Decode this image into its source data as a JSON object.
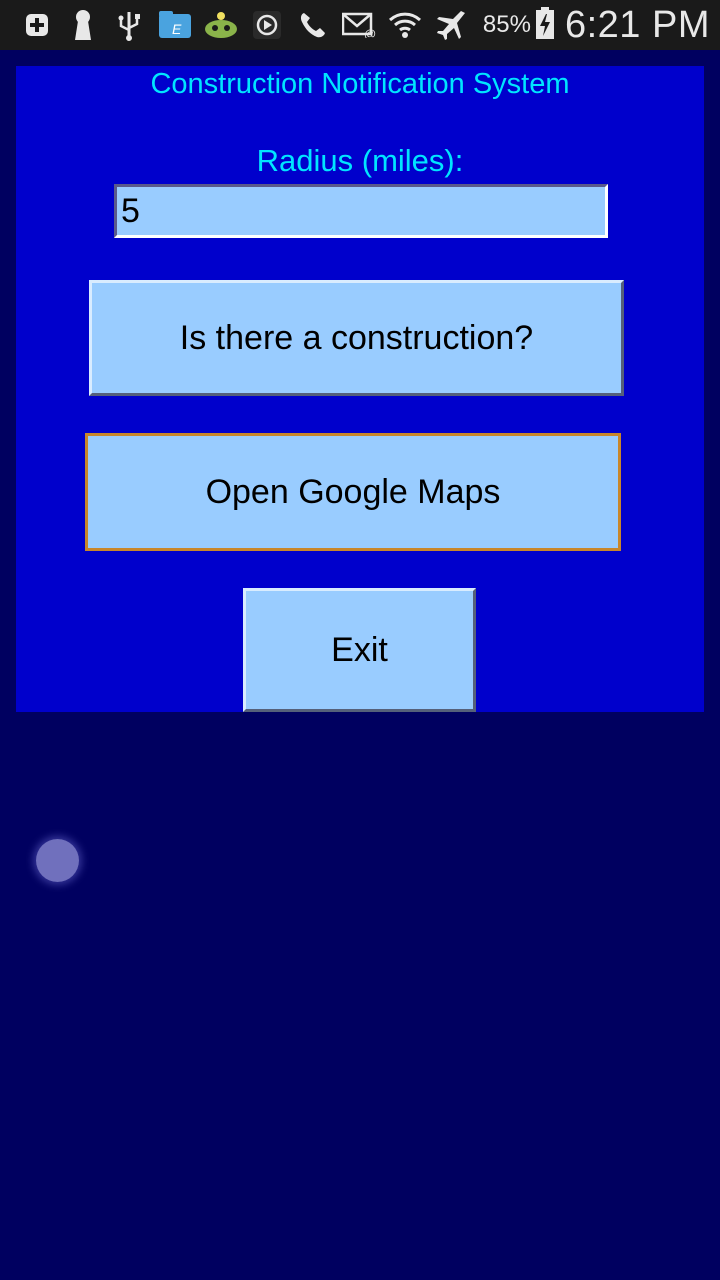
{
  "status_bar": {
    "icons": [
      "add-box-icon",
      "keyhole-icon",
      "usb-icon",
      "file-manager-icon",
      "android-icon",
      "play-icon",
      "phone-icon",
      "email-icon",
      "wifi-icon",
      "airplane-icon"
    ],
    "battery_percent": "85%",
    "time": "6:21 PM"
  },
  "app": {
    "title": "Construction Notification System",
    "radius_label": "Radius (miles):",
    "radius_value": "5",
    "construction_button": "Is there a construction?",
    "maps_button": "Open Google Maps",
    "exit_button": "Exit"
  },
  "colors": {
    "panel": "#0000cc",
    "background": "#000060",
    "text_accent": "#00e5ff",
    "button": "#99ccff"
  }
}
